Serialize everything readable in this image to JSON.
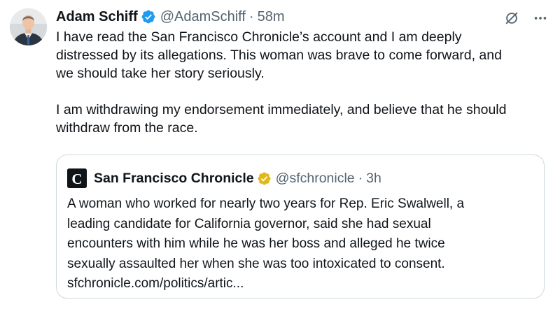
{
  "tweet": {
    "author": {
      "display_name": "Adam Schiff",
      "handle": "@AdamSchiff",
      "separator": "·",
      "time": "58m"
    },
    "text_lines": [
      "I have read the San Francisco Chronicle’s account and I am deeply",
      "distressed by its allegations. This woman was brave to come forward, and",
      "we should take her story seriously.",
      "I am withdrawing my endorsement immediately, and believe that he should",
      "withdraw from the race."
    ],
    "icons": {
      "verified": "blue-verified-badge-icon",
      "grok": "grok-icon",
      "more": "more-options-icon"
    },
    "colors": {
      "verified_blue": "#1d9bf0",
      "verified_gold": "#e2b719",
      "secondary_text": "#536471",
      "border": "#cfd9de"
    }
  },
  "quoted_tweet": {
    "author": {
      "display_name": "San Francisco Chronicle",
      "handle": "@sfchronicle",
      "separator": "·",
      "time": "3h",
      "logo_letter": "C"
    },
    "text_lines": [
      "A woman who worked for nearly two years for Rep. Eric Swalwell, a",
      "leading candidate for California governor, said she had sexual",
      "encounters with him while he was her boss and alleged he twice",
      "sexually assaulted her when she was too intoxicated to consent.",
      "sfchronicle.com/politics/artic..."
    ],
    "icons": {
      "logo": "chronicle-logo-icon",
      "verified": "gold-verified-badge-icon"
    }
  }
}
